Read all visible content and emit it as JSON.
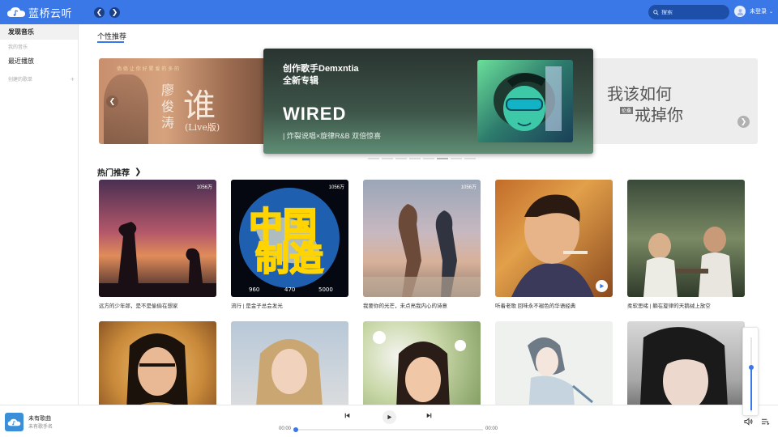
{
  "app": {
    "name": "蓝桥云听",
    "accent": "#3a78e8"
  },
  "topbar": {
    "back_icon": "chevron-left-icon",
    "forward_icon": "chevron-right-icon",
    "search_placeholder": "搜索",
    "login_label": "未登录"
  },
  "sidebar": {
    "items": [
      {
        "label": "发现音乐",
        "active": true
      },
      {
        "label": "我的音乐",
        "type": "group"
      },
      {
        "label": "最近播放"
      },
      {
        "label": "创建的歌单",
        "type": "group"
      }
    ]
  },
  "main": {
    "tab": "个性推荐",
    "banner": {
      "left": {
        "c1": "廖",
        "c2": "俊",
        "c3": "涛",
        "big": "谁",
        "sub": "(Live版)",
        "line": "倘 倘 让 你 好 累     爱 的 多 的"
      },
      "center": {
        "t1": "创作歌手Demxntia",
        "t2": "全新专辑",
        "t3": "WIRED",
        "t4": "| 炸裂说唱×旋律R&B 双倍惊喜"
      },
      "right": {
        "line1": "我该如何",
        "line2": "戒掉你",
        "tag": "伦桑"
      },
      "dot_count": 8,
      "active_dot": 5
    },
    "section_title": "热门推荐",
    "cards": [
      {
        "title": "远方的少年郎，是不是偷偷在想家",
        "plays": "1056万"
      },
      {
        "title": "流行 | 是金子总会发光",
        "plays": "1056万",
        "art": {
          "line1": "中国",
          "line2": "制造",
          "n1": "960",
          "n2": "470",
          "n3": "5000"
        }
      },
      {
        "title": "我要你的光芒，未点亮我内心的诗意",
        "plays": "1056万"
      },
      {
        "title": "听着老歌 回味永不褪色的华语经典",
        "plays": ""
      },
      {
        "title": "柔软思绪 | 躺在旋律的天鹅绒上放空",
        "plays": ""
      },
      {
        "title": "",
        "plays": ""
      },
      {
        "title": "",
        "plays": ""
      },
      {
        "title": "",
        "plays": ""
      },
      {
        "title": "",
        "plays": ""
      },
      {
        "title": "",
        "plays": ""
      }
    ],
    "volume_level": 0.58
  },
  "player": {
    "song": "未有歌曲",
    "artist": "未有歌手名",
    "current_time": "00:00",
    "total_time": "00:00",
    "progress": 0
  }
}
